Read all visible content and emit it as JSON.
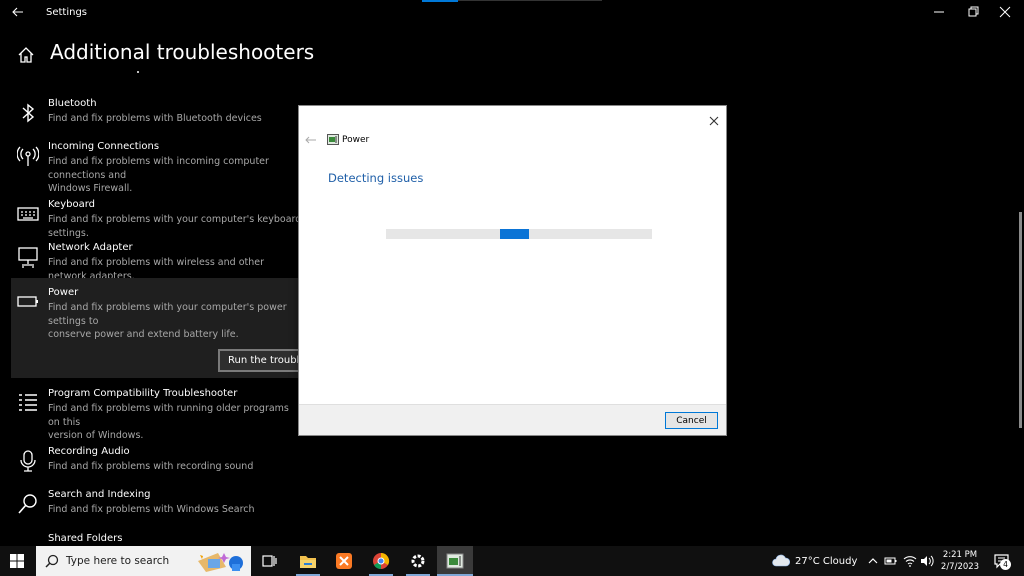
{
  "window": {
    "title": "Settings"
  },
  "page": {
    "title": "Additional troubleshooters"
  },
  "items": [
    {
      "name": "Bluetooth",
      "desc": "Find and fix problems with Bluetooth devices",
      "icon": "bluetooth-icon"
    },
    {
      "name": "Incoming Connections",
      "desc": "Find and fix problems with incoming computer connections and\nWindows Firewall.",
      "icon": "antenna-icon"
    },
    {
      "name": "Keyboard",
      "desc": "Find and fix problems with your computer's keyboard settings.",
      "icon": "keyboard-icon"
    },
    {
      "name": "Network Adapter",
      "desc": "Find and fix problems with wireless and other network adapters.",
      "icon": "network-icon"
    },
    {
      "name": "Power",
      "desc": "Find and fix problems with your computer's power settings to\nconserve power and extend battery life.",
      "icon": "battery-icon",
      "button": "Run the troubleshooter"
    },
    {
      "name": "Program Compatibility Troubleshooter",
      "desc": "Find and fix problems with running older programs on this\nversion of Windows.",
      "icon": "list-icon"
    },
    {
      "name": "Recording Audio",
      "desc": "Find and fix problems with recording sound",
      "icon": "microphone-icon"
    },
    {
      "name": "Search and Indexing",
      "desc": "Find and fix problems with Windows Search",
      "icon": "search-icon"
    },
    {
      "name": "Shared Folders",
      "desc": "",
      "icon": "folder-icon"
    }
  ],
  "dialog": {
    "context_label": "Power",
    "heading": "Detecting issues",
    "progress_start": 0.43,
    "progress_width": 0.11,
    "cancel_label": "Cancel"
  },
  "taskbar": {
    "search_placeholder": "Type here to search",
    "weather": "27°C  Cloudy",
    "time": "2:21 PM",
    "date": "2/7/2023",
    "notification_count": "4"
  },
  "colors": {
    "accent": "#0078d7",
    "dialog_heading": "#1f5fa8",
    "progress": "#0b74d6"
  }
}
